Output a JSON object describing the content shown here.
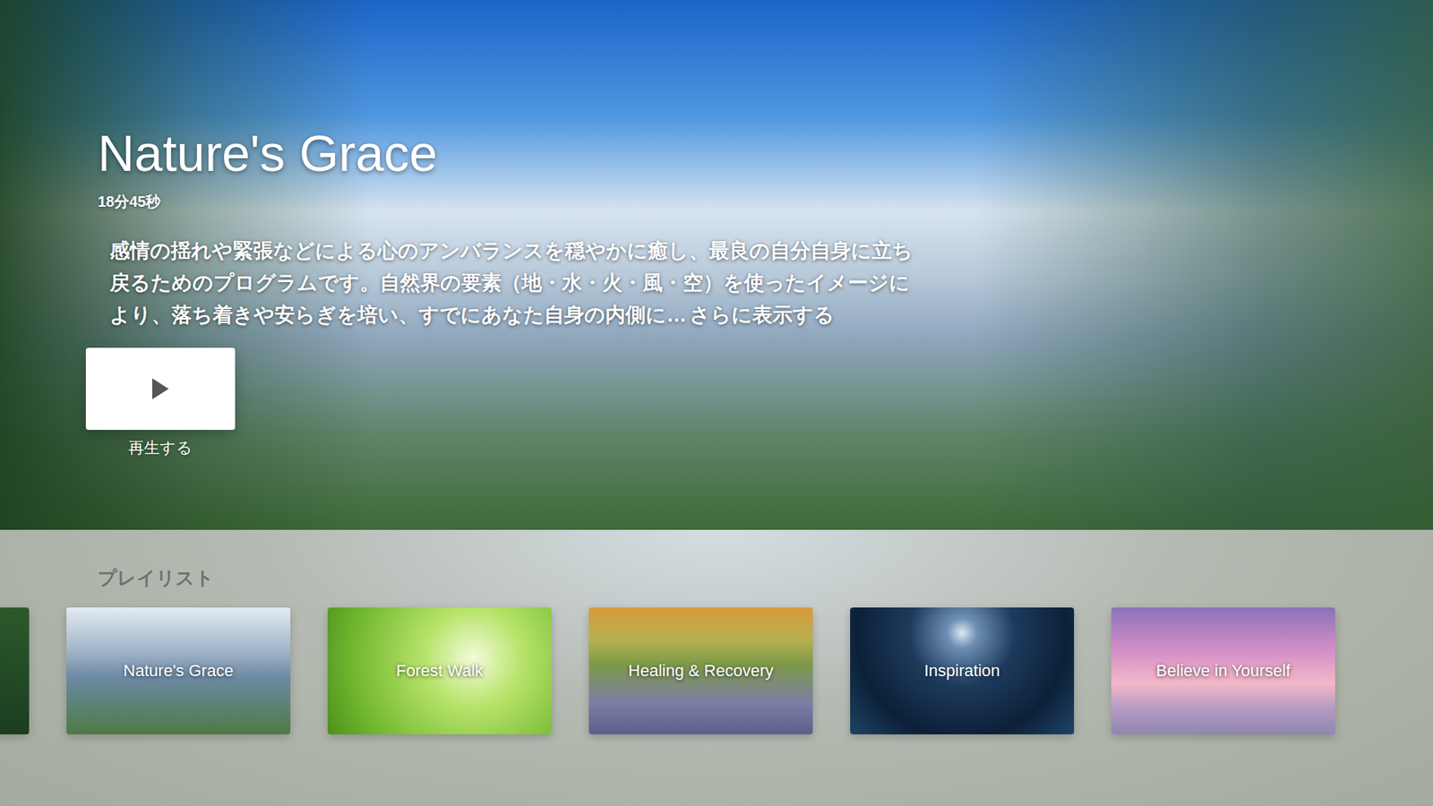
{
  "hero": {
    "title": "Nature's Grace",
    "duration": "18分45秒",
    "description": "感情の揺れや緊張などによる心のアンバランスを穏やかに癒し、最良の自分自身に立ち戻るためのプログラムです。自然界の要素（地・水・火・風・空）を使ったイメージにより、落ち着きや安らぎを培い、すでにあなた自身の内側に…",
    "more": "さらに表示する",
    "play_label": "再生する"
  },
  "playlists": {
    "heading": "プレイリスト",
    "items": [
      {
        "title": "Nature's Grace"
      },
      {
        "title": "Forest Walk"
      },
      {
        "title": "Healing & Recovery"
      },
      {
        "title": "Inspiration"
      },
      {
        "title": "Believe in Yourself"
      }
    ]
  }
}
